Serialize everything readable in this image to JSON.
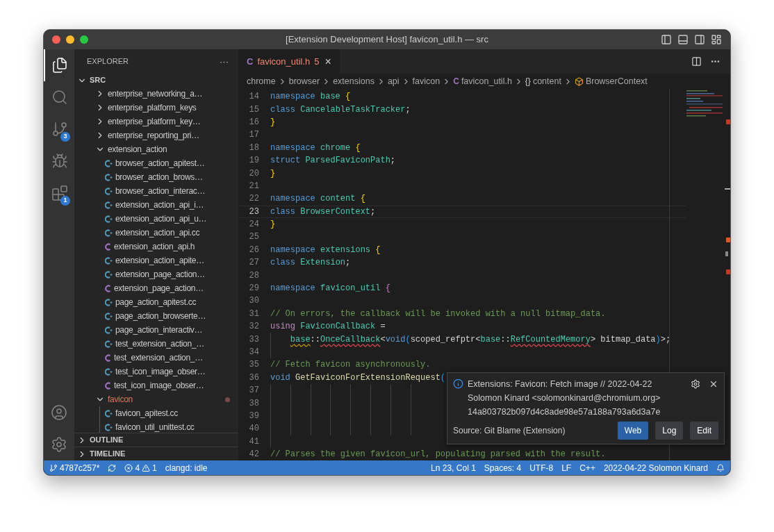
{
  "window": {
    "title": "[Extension Development Host] favicon_util.h — src"
  },
  "activity_bar": [
    {
      "kind": "files",
      "selected": true
    },
    {
      "kind": "search",
      "selected": false
    },
    {
      "kind": "source-control",
      "selected": false,
      "badge": "3"
    },
    {
      "kind": "run-debug",
      "selected": false
    },
    {
      "kind": "extensions",
      "selected": false,
      "badge": "1"
    }
  ],
  "activity_bar_bottom": [
    {
      "kind": "account"
    },
    {
      "kind": "settings"
    }
  ],
  "sidebar": {
    "title": "EXPLORER",
    "more": "···",
    "root": {
      "label": "SRC",
      "expanded": true
    },
    "items": [
      {
        "label": "enterprise_networking_a…",
        "kind": "folder",
        "expanded": false,
        "modified": false
      },
      {
        "label": "enterprise_platform_keys",
        "kind": "folder",
        "expanded": false,
        "modified": false
      },
      {
        "label": "enterprise_platform_key…",
        "kind": "folder",
        "expanded": false,
        "modified": false
      },
      {
        "label": "enterprise_reporting_pri…",
        "kind": "folder",
        "expanded": false,
        "modified": false
      },
      {
        "label": "extension_action",
        "kind": "folder",
        "expanded": true,
        "modified": false,
        "children": [
          {
            "label": "browser_action_apitest…",
            "kind": "cpp"
          },
          {
            "label": "browser_action_brows…",
            "kind": "cpp"
          },
          {
            "label": "browser_action_interac…",
            "kind": "cpp"
          },
          {
            "label": "extension_action_api_i…",
            "kind": "cpp"
          },
          {
            "label": "extension_action_api_u…",
            "kind": "cpp"
          },
          {
            "label": "extension_action_api.cc",
            "kind": "cpp"
          },
          {
            "label": "extension_action_api.h",
            "kind": "h"
          },
          {
            "label": "extension_action_apite…",
            "kind": "cpp"
          },
          {
            "label": "extension_page_action…",
            "kind": "cpp"
          },
          {
            "label": "extension_page_action…",
            "kind": "h"
          },
          {
            "label": "page_action_apitest.cc",
            "kind": "cpp"
          },
          {
            "label": "page_action_browserte…",
            "kind": "cpp"
          },
          {
            "label": "page_action_interactiv…",
            "kind": "cpp"
          },
          {
            "label": "test_extension_action_…",
            "kind": "cpp"
          },
          {
            "label": "test_extension_action_…",
            "kind": "h"
          },
          {
            "label": "test_icon_image_obser…",
            "kind": "cpp"
          },
          {
            "label": "test_icon_image_obser…",
            "kind": "h"
          }
        ]
      },
      {
        "label": "favicon",
        "kind": "folder",
        "expanded": true,
        "modified": true,
        "children": [
          {
            "label": "favicon_apitest.cc",
            "kind": "cpp"
          },
          {
            "label": "favicon_util_unittest.cc",
            "kind": "cpp"
          }
        ]
      }
    ],
    "sections": [
      {
        "label": "OUTLINE",
        "expanded": false
      },
      {
        "label": "TIMELINE",
        "expanded": false
      }
    ]
  },
  "tabs": [
    {
      "label": "favicon_util.h",
      "icon": "C",
      "problems": "5",
      "selected": true,
      "close": "×"
    }
  ],
  "breadcrumbs": [
    {
      "label": "chrome",
      "kind": "folder"
    },
    {
      "label": "browser",
      "kind": "folder"
    },
    {
      "label": "extensions",
      "kind": "folder"
    },
    {
      "label": "api",
      "kind": "folder"
    },
    {
      "label": "favicon",
      "kind": "folder"
    },
    {
      "label": "favicon_util.h",
      "kind": "file",
      "icon": "C"
    },
    {
      "label": "content",
      "kind": "namespace",
      "icon": "{}"
    },
    {
      "label": "BrowserContext",
      "kind": "class"
    }
  ],
  "code": [
    {
      "number": "14",
      "kind": "code",
      "current": false,
      "tokens": [
        {
          "text": "namespace ",
          "kind": "keyword"
        },
        {
          "text": "base ",
          "kind": "type"
        },
        {
          "text": "{",
          "kind": "brace1"
        }
      ]
    },
    {
      "number": "15",
      "kind": "code",
      "current": false,
      "tokens": [
        {
          "text": "class ",
          "kind": "keyword"
        },
        {
          "text": "CancelableTaskTracker",
          "kind": "type"
        },
        {
          "text": ";",
          "kind": "plain"
        }
      ]
    },
    {
      "number": "16",
      "kind": "code",
      "current": false,
      "tokens": [
        {
          "text": "}",
          "kind": "brace1"
        }
      ]
    },
    {
      "number": "17",
      "kind": "code",
      "current": false
    },
    {
      "number": "18",
      "kind": "code",
      "current": false,
      "tokens": [
        {
          "text": "namespace ",
          "kind": "keyword"
        },
        {
          "text": "chrome ",
          "kind": "type"
        },
        {
          "text": "{",
          "kind": "brace1"
        }
      ]
    },
    {
      "number": "19",
      "kind": "code",
      "current": false,
      "tokens": [
        {
          "text": "struct ",
          "kind": "keyword"
        },
        {
          "text": "ParsedFaviconPath",
          "kind": "type"
        },
        {
          "text": ";",
          "kind": "plain"
        }
      ]
    },
    {
      "number": "20",
      "kind": "code",
      "current": false,
      "tokens": [
        {
          "text": "}",
          "kind": "brace1"
        }
      ]
    },
    {
      "number": "21",
      "kind": "code",
      "current": false
    },
    {
      "number": "22",
      "kind": "code",
      "current": false,
      "tokens": [
        {
          "text": "namespace ",
          "kind": "keyword"
        },
        {
          "text": "content ",
          "kind": "type"
        },
        {
          "text": "{",
          "kind": "brace1"
        }
      ]
    },
    {
      "number": "23",
      "kind": "code",
      "current": true,
      "tokens": [
        {
          "text": "class ",
          "kind": "keyword"
        },
        {
          "text": "BrowserContext",
          "kind": "type"
        },
        {
          "text": ";",
          "kind": "plain"
        }
      ]
    },
    {
      "number": "24",
      "kind": "code",
      "current": false,
      "tokens": [
        {
          "text": "}",
          "kind": "brace1"
        }
      ]
    },
    {
      "number": "25",
      "kind": "code",
      "current": false
    },
    {
      "number": "26",
      "kind": "code",
      "current": false,
      "tokens": [
        {
          "text": "namespace ",
          "kind": "keyword"
        },
        {
          "text": "extensions ",
          "kind": "type"
        },
        {
          "text": "{",
          "kind": "brace1"
        }
      ]
    },
    {
      "number": "27",
      "kind": "code",
      "current": false,
      "tokens": [
        {
          "text": "class ",
          "kind": "keyword"
        },
        {
          "text": "Extension",
          "kind": "type"
        },
        {
          "text": ";",
          "kind": "plain"
        }
      ]
    },
    {
      "number": "28",
      "kind": "code",
      "current": false
    },
    {
      "number": "29",
      "kind": "code",
      "current": false,
      "tokens": [
        {
          "text": "namespace ",
          "kind": "keyword"
        },
        {
          "text": "favicon_util ",
          "kind": "type"
        },
        {
          "text": "{",
          "kind": "brace2"
        }
      ]
    },
    {
      "number": "30",
      "kind": "code",
      "current": false
    },
    {
      "number": "31",
      "kind": "code",
      "current": false,
      "tokens": [
        {
          "text": "// On errors, the callback will be invoked with a null bitmap_data.",
          "kind": "comment"
        }
      ]
    },
    {
      "number": "32",
      "kind": "code",
      "current": false,
      "tokens": [
        {
          "text": "using ",
          "kind": "control"
        },
        {
          "text": "FaviconCallback ",
          "kind": "type"
        },
        {
          "text": "=",
          "kind": "plain"
        }
      ]
    },
    {
      "number": "33",
      "kind": "indented",
      "current": false,
      "tokens": [
        {
          "text": "base",
          "kind": "type",
          "warning": true
        },
        {
          "text": "::",
          "kind": "plain"
        },
        {
          "text": "OnceCallback",
          "kind": "type",
          "error": true
        },
        {
          "text": "<",
          "kind": "plain"
        },
        {
          "text": "void",
          "kind": "keyword"
        },
        {
          "text": "(",
          "kind": "brace3"
        },
        {
          "text": "scoped_refptr<",
          "kind": "plain"
        },
        {
          "text": "base",
          "kind": "type"
        },
        {
          "text": "::",
          "kind": "plain"
        },
        {
          "text": "RefCountedMemory",
          "kind": "type",
          "error": true
        },
        {
          "text": "> bitmap_data",
          "kind": "plain"
        },
        {
          "text": ")",
          "kind": "brace3"
        },
        {
          "text": ">;",
          "kind": "plain"
        }
      ]
    },
    {
      "number": "34",
      "kind": "indented",
      "current": false
    },
    {
      "number": "35",
      "kind": "code",
      "current": false,
      "tokens": [
        {
          "text": "// Fetch favicon asynchronously.",
          "kind": "comment"
        }
      ]
    },
    {
      "number": "36",
      "kind": "code",
      "current": false,
      "tokens": [
        {
          "text": "void ",
          "kind": "keyword"
        },
        {
          "text": "GetFaviconForExtensionRequest",
          "kind": "function"
        },
        {
          "text": "(",
          "kind": "brace3"
        }
      ]
    },
    {
      "number": "37",
      "kind": "continuation",
      "current": false
    },
    {
      "number": "38",
      "kind": "continuation",
      "current": false
    },
    {
      "number": "39",
      "kind": "continuation",
      "current": false
    },
    {
      "number": "40",
      "kind": "continuation",
      "current": false
    },
    {
      "number": "41",
      "kind": "indented",
      "current": false
    },
    {
      "number": "42",
      "kind": "code",
      "current": false,
      "tokens": [
        {
          "text": "// Parses the given favicon_url, populating parsed with the result.",
          "kind": "comment"
        }
      ]
    }
  ],
  "hover": {
    "message": "Extensions: Favicon: Fetch image // 2022-04-22 Solomon Kinard <solomonkinard@chromium.org>",
    "detail": "14a803782b097d4c8ade98e57a188a793a6d3a7e",
    "source": "Source: Git Blame (Extension)",
    "buttons": [
      {
        "label": "Web",
        "primary": true
      },
      {
        "label": "Log",
        "primary": false
      },
      {
        "label": "Edit",
        "primary": false
      }
    ]
  },
  "status_bar": {
    "branch": "4787c257*",
    "errors": "4",
    "warnings": "1",
    "left": [
      "clangd: idle"
    ],
    "right": [
      "Ln 23, Col 1",
      "Spaces: 4",
      "UTF-8",
      "LF",
      "C++",
      "2022-04-22 Solomon Kinard"
    ]
  }
}
